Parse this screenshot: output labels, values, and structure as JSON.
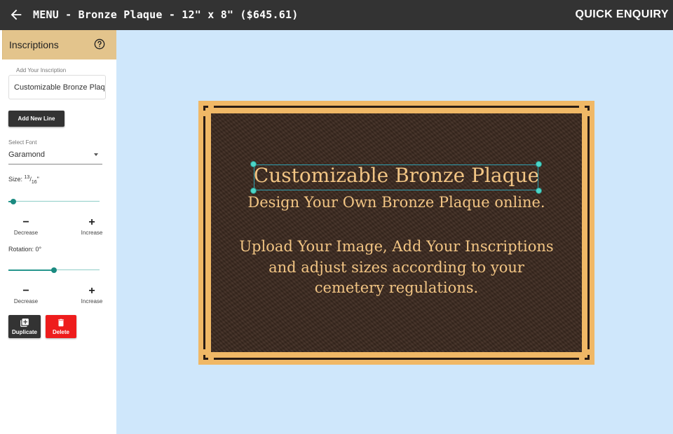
{
  "header": {
    "title": "MENU - Bronze Plaque - 12\" x 8\" ($645.61)",
    "quick_enquiry": "QUICK ENQUIRY"
  },
  "sidebar": {
    "panel_title": "Inscriptions",
    "inscription": {
      "label": "Add Your Inscription",
      "value": "Customizable Bronze Plaque"
    },
    "add_line_label": "Add New Line",
    "font": {
      "label": "Select Font",
      "value": "Garamond"
    },
    "size": {
      "label": "Size:",
      "numerator": "13",
      "denominator": "16",
      "unit": "\"",
      "slider_fraction": 0.05,
      "decrease_label": "Decrease",
      "increase_label": "Increase"
    },
    "rotation": {
      "label": "Rotation: 0°",
      "slider_fraction": 0.5,
      "decrease_label": "Decrease",
      "increase_label": "Increase"
    },
    "duplicate_label": "Duplicate",
    "delete_label": "Delete"
  },
  "plaque": {
    "lines": [
      "Customizable Bronze Plaque",
      "Design Your Own Bronze Plaque online.",
      "Upload Your Image, Add Your Inscriptions",
      "and adjust sizes according to your",
      "cemetery regulations."
    ]
  },
  "colors": {
    "header_bg": "#333333",
    "panel_header": "#e3c48c",
    "canvas_bg": "#cfe7fb",
    "plaque_border": "#f0b866",
    "plaque_field": "#3e2b21",
    "plaque_text": "#f2c584",
    "slider_accent": "#26968d",
    "delete_red": "#ee1c1c"
  },
  "icons": {
    "back": "arrow-left-icon",
    "help": "help-circle-icon",
    "dropdown": "caret-down-icon",
    "duplicate": "library-add-icon",
    "delete": "trash-icon"
  }
}
